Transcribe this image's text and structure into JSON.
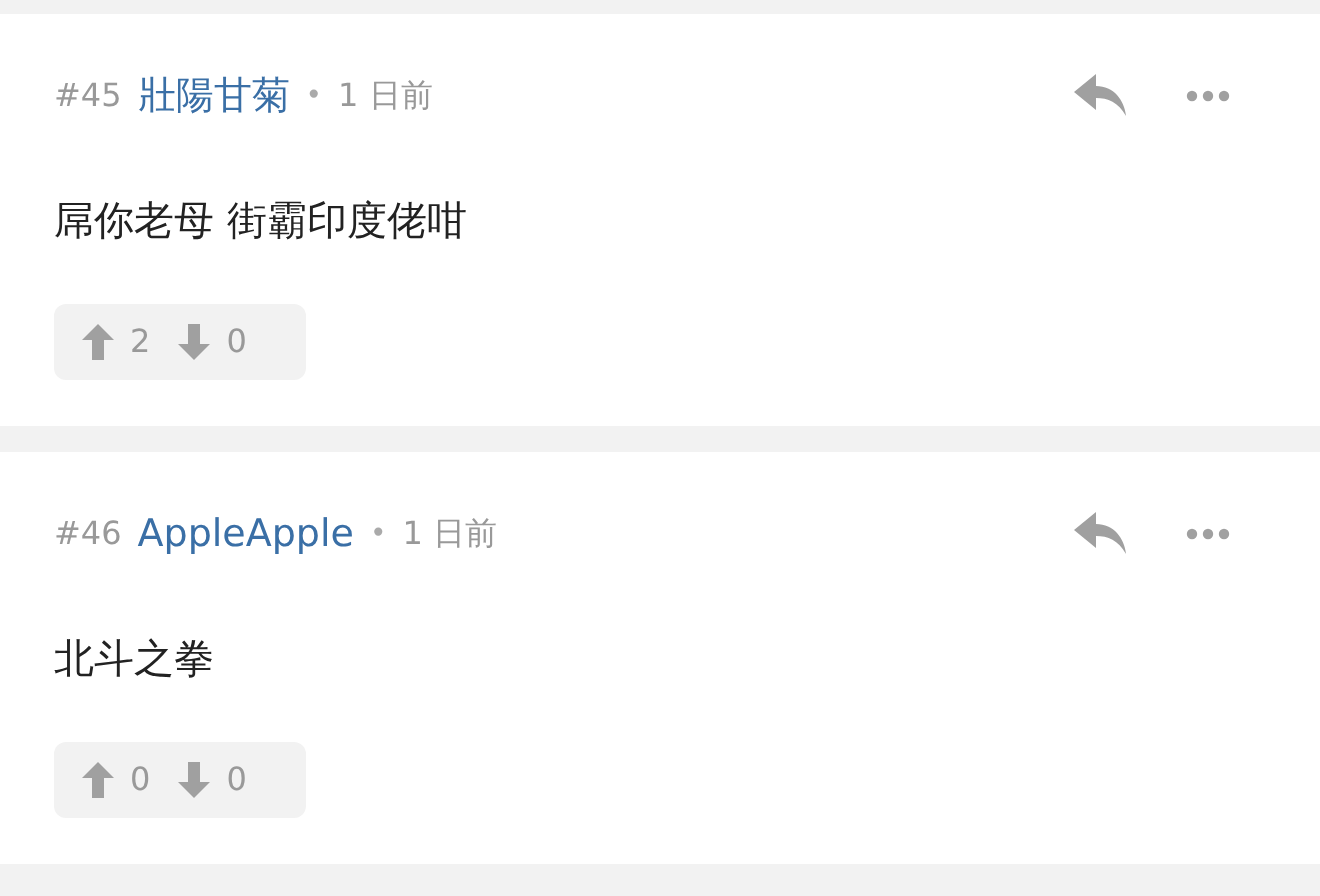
{
  "comments": [
    {
      "number": "#45",
      "author": "壯陽甘菊",
      "separator": "•",
      "time": "1 日前",
      "body": "屌你老母 街霸印度佬咁",
      "upvotes": "2",
      "downvotes": "0"
    },
    {
      "number": "#46",
      "author": "AppleApple",
      "separator": "•",
      "time": "1 日前",
      "body": "北斗之拳",
      "upvotes": "0",
      "downvotes": "0"
    }
  ]
}
